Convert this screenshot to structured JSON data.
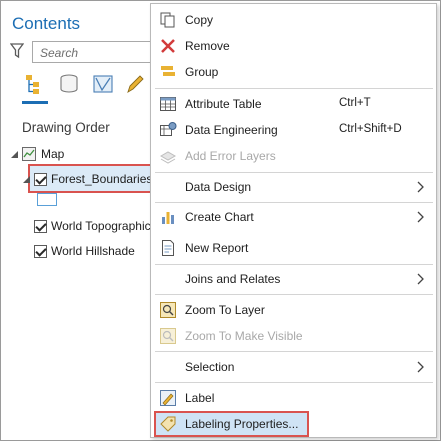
{
  "pane": {
    "title": "Contents",
    "search_placeholder": "Search",
    "drawing_order_label": "Drawing Order",
    "layers": [
      {
        "label": "Map"
      },
      {
        "label": "Forest_Boundaries"
      },
      {
        "label": "World Topographic"
      },
      {
        "label": "World Hillshade"
      }
    ]
  },
  "menu": {
    "items": [
      {
        "label": "Copy",
        "shortcut": ""
      },
      {
        "label": "Remove",
        "shortcut": ""
      },
      {
        "label": "Group",
        "shortcut": ""
      },
      {
        "label": "Attribute Table",
        "shortcut": "Ctrl+T"
      },
      {
        "label": "Data Engineering",
        "shortcut": "Ctrl+Shift+D"
      },
      {
        "label": "Add Error Layers",
        "shortcut": ""
      },
      {
        "label": "Data Design",
        "shortcut": ""
      },
      {
        "label": "Create Chart",
        "shortcut": ""
      },
      {
        "label": "New Report",
        "shortcut": ""
      },
      {
        "label": "Joins and Relates",
        "shortcut": ""
      },
      {
        "label": "Zoom To Layer",
        "shortcut": ""
      },
      {
        "label": "Zoom To Make Visible",
        "shortcut": ""
      },
      {
        "label": "Selection",
        "shortcut": ""
      },
      {
        "label": "Label",
        "shortcut": ""
      },
      {
        "label": "Labeling Properties...",
        "shortcut": ""
      }
    ]
  },
  "colors": {
    "accent": "#1c6eb4",
    "highlight_border": "#d9534f",
    "selection_fill": "#dbeaf7"
  }
}
